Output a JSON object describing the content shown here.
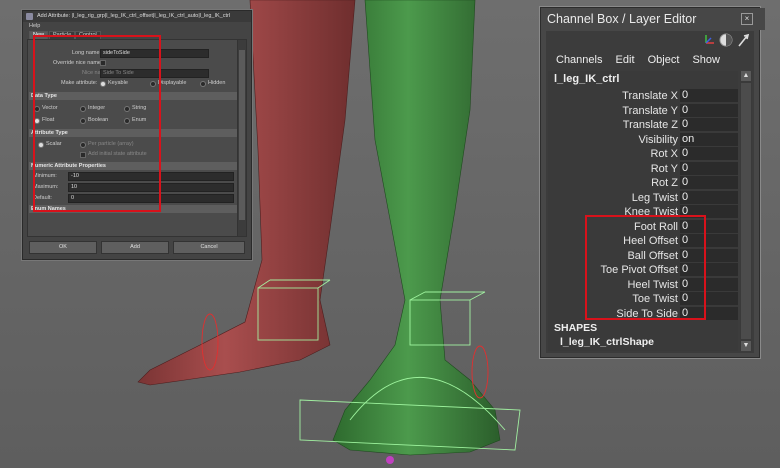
{
  "add_attribute": {
    "title": "Add Attribute: |l_leg_rig_grp|l_leg_IK_ctrl_offset|l_leg_IK_ctrl_auto|l_leg_IK_ctrl",
    "menu_help": "Help",
    "tabs": [
      "New",
      "Particle",
      "Control"
    ],
    "long_name_label": "Long name:",
    "long_name_value": "sideToSide",
    "override_label": "Override nice name:",
    "nice_name_label": "Nice name:",
    "nice_name_value": "Side To Side",
    "make_attribute_label": "Make attribute:",
    "make_attribute_options": [
      "Keyable",
      "Displayable",
      "Hidden"
    ],
    "data_type_header": "Data Type",
    "data_types": [
      "Vector",
      "Integer",
      "String",
      "Float",
      "Boolean",
      "Enum"
    ],
    "attribute_type_header": "Attribute Type",
    "attr_types": [
      "Scalar",
      "Per particle (array)"
    ],
    "add_initial_state": "Add initial state attribute",
    "numeric_header": "Numeric Attribute Properties",
    "minimum_label": "Minimum:",
    "minimum_value": "-10",
    "maximum_label": "Maximum:",
    "maximum_value": "10",
    "default_label": "Default:",
    "default_value": "0",
    "enum_header": "Enum Names",
    "buttons": {
      "ok": "OK",
      "add": "Add",
      "cancel": "Cancel"
    }
  },
  "channel_box": {
    "title": "Channel Box / Layer Editor",
    "menu": [
      "Channels",
      "Edit",
      "Object",
      "Show"
    ],
    "node_name": "l_leg_IK_ctrl",
    "channels": [
      {
        "label": "Translate X",
        "value": "0"
      },
      {
        "label": "Translate Y",
        "value": "0"
      },
      {
        "label": "Translate Z",
        "value": "0"
      },
      {
        "label": "Visibility",
        "value": "on"
      },
      {
        "label": "Rot X",
        "value": "0"
      },
      {
        "label": "Rot Y",
        "value": "0"
      },
      {
        "label": "Rot Z",
        "value": "0"
      },
      {
        "label": "Leg Twist",
        "value": "0"
      },
      {
        "label": "Knee Twist",
        "value": "0"
      },
      {
        "label": "Foot Roll",
        "value": "0"
      },
      {
        "label": "Heel Offset",
        "value": "0"
      },
      {
        "label": "Ball Offset",
        "value": "0"
      },
      {
        "label": "Toe Pivot Offset",
        "value": "0"
      },
      {
        "label": "Heel Twist",
        "value": "0"
      },
      {
        "label": "Toe Twist",
        "value": "0"
      },
      {
        "label": "Side To Side",
        "value": "0"
      }
    ],
    "shapes_label": "SHAPES",
    "shape_node": "l_leg_IK_ctrlShape"
  },
  "colors": {
    "highlight": "#d8121b",
    "left_leg": "#9c4747",
    "right_leg": "#3f8a3f",
    "wire": "#9cff9c"
  }
}
